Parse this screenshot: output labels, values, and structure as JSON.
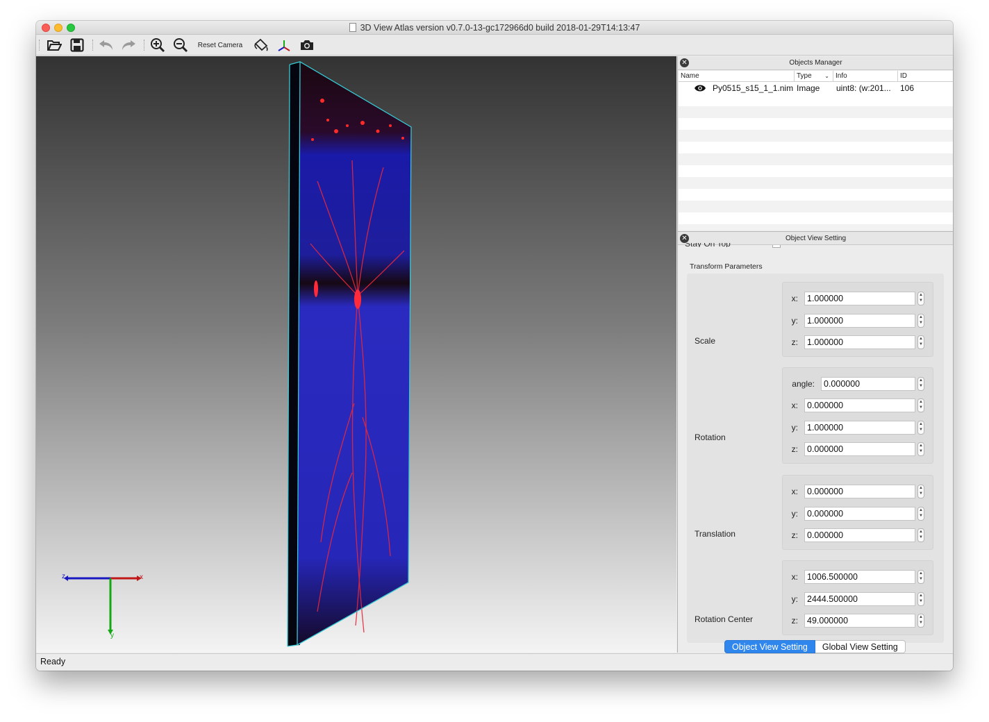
{
  "window": {
    "title": "3D View  Atlas version v0.7.0-13-gc172966d0 build 2018-01-29T14:13:47"
  },
  "toolbar": {
    "open_icon": "folder-open-icon",
    "save_icon": "save-icon",
    "undo_icon": "undo-icon",
    "redo_icon": "redo-icon",
    "zoom_in_icon": "zoom-in-icon",
    "zoom_out_icon": "zoom-out-icon",
    "reset_camera_label": "Reset Camera",
    "paint_icon": "paint-bucket-icon",
    "axes_icon": "axes-icon",
    "screenshot_icon": "camera-icon"
  },
  "viewport": {
    "axis_labels": {
      "x": "x",
      "y": "y",
      "z": "z"
    },
    "colors": {
      "x_axis": "#c01818",
      "y_axis": "#14a814",
      "z_axis": "#1818c0",
      "slab_edge": "#37c9d4"
    }
  },
  "objects_manager": {
    "title": "Objects Manager",
    "columns": [
      "Name",
      "Type",
      "Info",
      "ID"
    ],
    "rows": [
      {
        "visible_icon": "eye-icon",
        "name": "Py0515_s15_1_1.nim",
        "type": "Image",
        "info": "uint8: (w:201...",
        "id": "106"
      }
    ]
  },
  "object_view_setting": {
    "title": "Object View Setting",
    "cut_off_text": "Stay On Top",
    "transform_title": "Transform Parameters",
    "scale": {
      "label": "Scale",
      "fields": [
        {
          "label": "x:",
          "value": "1.000000"
        },
        {
          "label": "y:",
          "value": "1.000000"
        },
        {
          "label": "z:",
          "value": "1.000000"
        }
      ]
    },
    "rotation": {
      "label": "Rotation",
      "fields": [
        {
          "label": "angle:",
          "value": "0.000000"
        },
        {
          "label": "x:",
          "value": "0.000000"
        },
        {
          "label": "y:",
          "value": "1.000000"
        },
        {
          "label": "z:",
          "value": "0.000000"
        }
      ]
    },
    "translation": {
      "label": "Translation",
      "fields": [
        {
          "label": "x:",
          "value": "0.000000"
        },
        {
          "label": "y:",
          "value": "0.000000"
        },
        {
          "label": "z:",
          "value": "0.000000"
        }
      ]
    },
    "rotation_center": {
      "label": "Rotation Center",
      "fields": [
        {
          "label": "x:",
          "value": "1006.500000"
        },
        {
          "label": "y:",
          "value": "2444.500000"
        },
        {
          "label": "z:",
          "value": "49.000000"
        }
      ]
    },
    "tabs": {
      "active": "Object View Setting",
      "inactive": "Global View Setting"
    }
  },
  "status": {
    "text": "Ready"
  }
}
